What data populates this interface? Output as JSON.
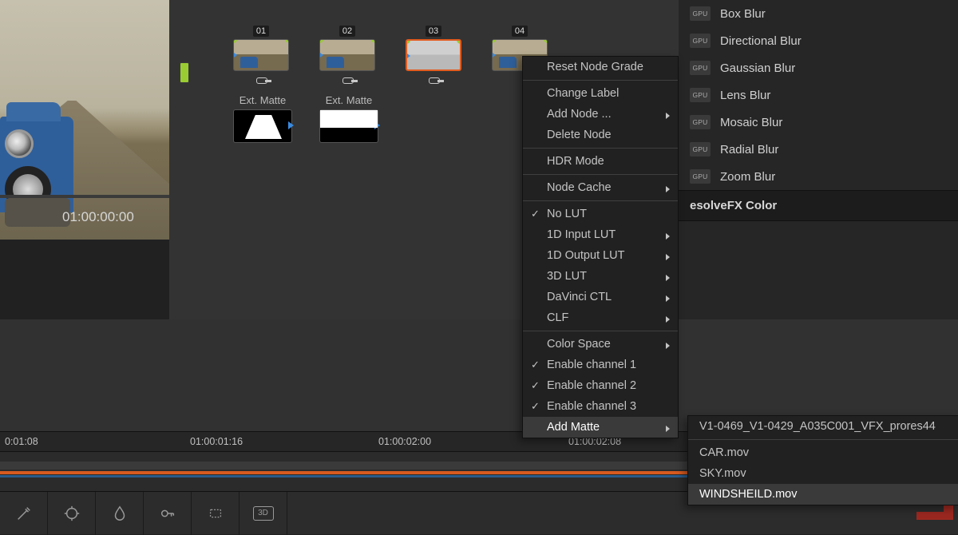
{
  "viewer": {
    "timecode": "01:00:00:00"
  },
  "nodes": [
    {
      "label": "01"
    },
    {
      "label": "02"
    },
    {
      "label": "03"
    },
    {
      "label": "04"
    }
  ],
  "mattes": [
    {
      "label": "Ext. Matte"
    },
    {
      "label": "Ext. Matte"
    }
  ],
  "context_menu": {
    "reset": "Reset Node Grade",
    "change_label": "Change Label",
    "add_node": "Add Node ...",
    "delete_node": "Delete Node",
    "hdr": "HDR Mode",
    "node_cache": "Node Cache",
    "no_lut": "No LUT",
    "lut_1d_in": "1D Input LUT",
    "lut_1d_out": "1D Output LUT",
    "lut_3d": "3D LUT",
    "davinci_ctl": "DaVinci CTL",
    "clf": "CLF",
    "color_space": "Color Space",
    "en_ch1": "Enable channel 1",
    "en_ch2": "Enable channel 2",
    "en_ch3": "Enable channel 3",
    "add_matte": "Add Matte"
  },
  "submenu": {
    "item0": "V1-0469_V1-0429_A035C001_VFX_prores44",
    "item1": "CAR.mov",
    "item2": "SKY.mov",
    "item3": "WINDSHEILD.mov"
  },
  "fx": {
    "gpu_badge": "GPU",
    "box_blur": "Box Blur",
    "dir_blur": "Directional Blur",
    "gauss_blur": "Gaussian Blur",
    "lens_blur": "Lens Blur",
    "mosaic_blur": "Mosaic Blur",
    "radial_blur": "Radial Blur",
    "zoom_blur": "Zoom Blur",
    "header_color": "esolveFX Color"
  },
  "ruler": {
    "t0": "0:01:08",
    "t1": "01:00:01:16",
    "t2": "01:00:02:00",
    "t3": "01:00:02:08"
  },
  "toolbar": {
    "btn_3d": "3D"
  }
}
